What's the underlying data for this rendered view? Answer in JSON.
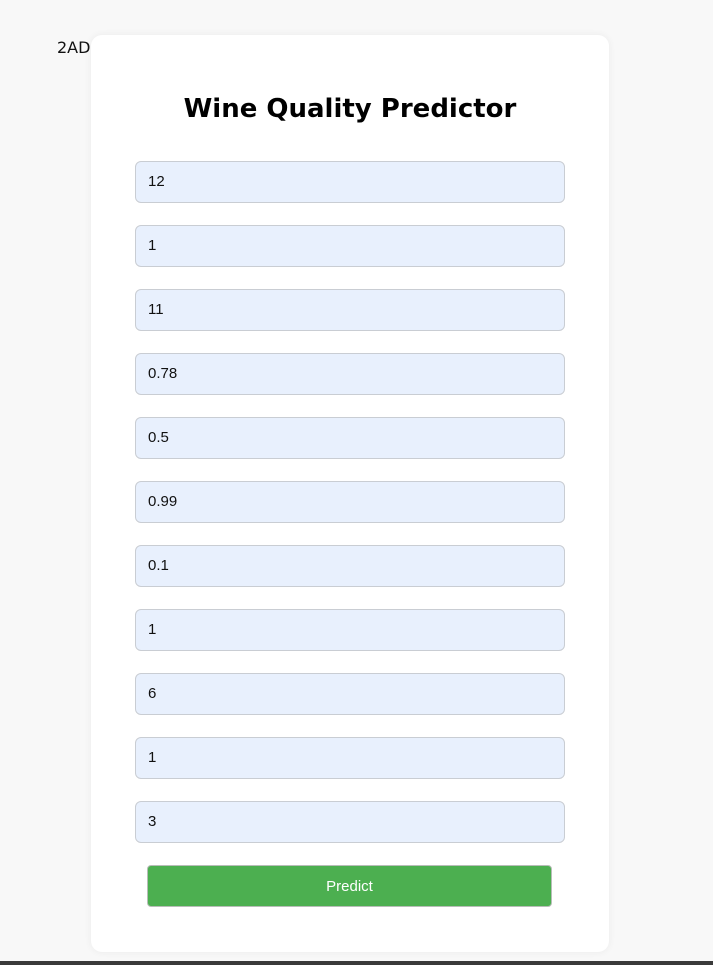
{
  "corner_label": "2AD",
  "form": {
    "title": "Wine Quality Predictor",
    "fields": [
      {
        "value": "12"
      },
      {
        "value": "1"
      },
      {
        "value": "11"
      },
      {
        "value": "0.78"
      },
      {
        "value": "0.5"
      },
      {
        "value": "0.99"
      },
      {
        "value": "0.1"
      },
      {
        "value": "1"
      },
      {
        "value": "6"
      },
      {
        "value": "1"
      },
      {
        "value": "3"
      }
    ],
    "submit_label": "Predict"
  },
  "colors": {
    "page_background": "#f8f8f8",
    "card_background": "#ffffff",
    "field_background": "#e8f0fd",
    "button_background": "#4caf50",
    "button_text": "#ffffff"
  }
}
